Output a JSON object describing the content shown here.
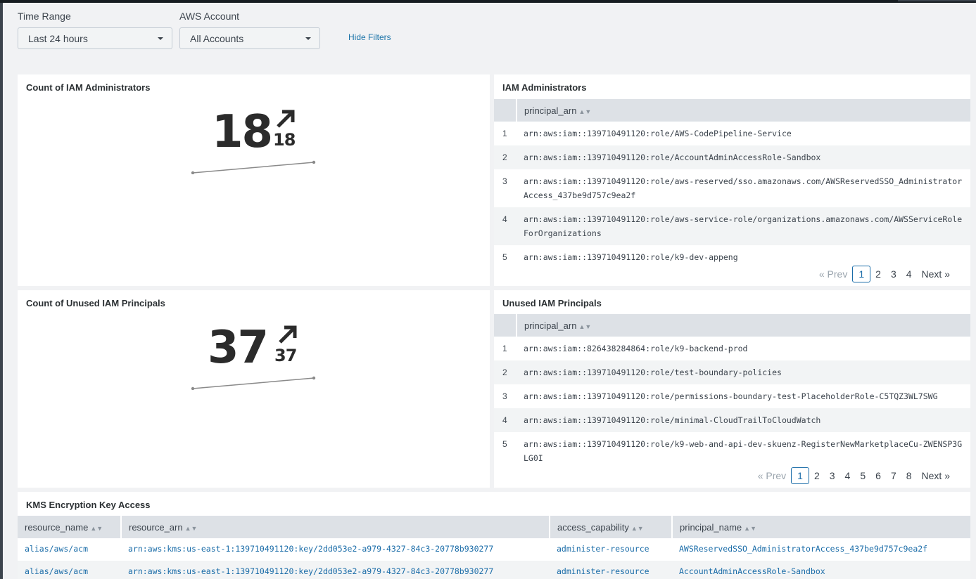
{
  "filters": {
    "time_range": {
      "label": "Time Range",
      "value": "Last 24 hours"
    },
    "aws_account": {
      "label": "AWS Account",
      "value": "All Accounts"
    },
    "hide_filters_label": "Hide Filters"
  },
  "panels": {
    "count_admins": {
      "title": "Count of IAM Administrators",
      "value": "18",
      "delta": "18",
      "trend_icon": "arrow-up-right-icon",
      "sparkline": [
        0,
        18
      ]
    },
    "iam_admins": {
      "title": "IAM Administrators",
      "columns": [
        "principal_arn"
      ],
      "rows": [
        {
          "idx": "1",
          "principal_arn": "arn:aws:iam::139710491120:role/AWS-CodePipeline-Service"
        },
        {
          "idx": "2",
          "principal_arn": "arn:aws:iam::139710491120:role/AccountAdminAccessRole-Sandbox"
        },
        {
          "idx": "3",
          "principal_arn": "arn:aws:iam::139710491120:role/aws-reserved/sso.amazonaws.com/AWSReservedSSO_AdministratorAccess_437be9d757c9ea2f"
        },
        {
          "idx": "4",
          "principal_arn": "arn:aws:iam::139710491120:role/aws-service-role/organizations.amazonaws.com/AWSServiceRoleForOrganizations"
        },
        {
          "idx": "5",
          "principal_arn": "arn:aws:iam::139710491120:role/k9-dev-appeng"
        }
      ],
      "pager": {
        "prev": "« Prev",
        "pages": [
          "1",
          "2",
          "3",
          "4"
        ],
        "current": "1",
        "next": "Next »"
      }
    },
    "count_unused": {
      "title": "Count of Unused IAM Principals",
      "value": "37",
      "delta": "37",
      "trend_icon": "arrow-up-right-icon",
      "sparkline": [
        0,
        37
      ]
    },
    "unused_principals": {
      "title": "Unused IAM Principals",
      "columns": [
        "principal_arn"
      ],
      "rows": [
        {
          "idx": "1",
          "principal_arn": "arn:aws:iam::826438284864:role/k9-backend-prod"
        },
        {
          "idx": "2",
          "principal_arn": "arn:aws:iam::139710491120:role/test-boundary-policies"
        },
        {
          "idx": "3",
          "principal_arn": "arn:aws:iam::139710491120:role/permissions-boundary-test-PlaceholderRole-C5TQZ3WL7SWG"
        },
        {
          "idx": "4",
          "principal_arn": "arn:aws:iam::139710491120:role/minimal-CloudTrailToCloudWatch"
        },
        {
          "idx": "5",
          "principal_arn": "arn:aws:iam::139710491120:role/k9-web-and-api-dev-skuenz-RegisterNewMarketplaceCu-ZWENSP3GLG0I"
        }
      ],
      "pager": {
        "prev": "« Prev",
        "pages": [
          "1",
          "2",
          "3",
          "4",
          "5",
          "6",
          "7",
          "8"
        ],
        "current": "1",
        "next": "Next »"
      }
    },
    "kms": {
      "title": "KMS Encryption Key Access",
      "columns": [
        "resource_name",
        "resource_arn",
        "access_capability",
        "principal_name"
      ],
      "rows": [
        {
          "resource_name": "alias/aws/acm",
          "resource_arn": "arn:aws:kms:us-east-1:139710491120:key/2dd053e2-a979-4327-84c3-20778b930277",
          "access_capability": "administer-resource",
          "principal_name": "AWSReservedSSO_AdministratorAccess_437be9d757c9ea2f"
        },
        {
          "resource_name": "alias/aws/acm",
          "resource_arn": "arn:aws:kms:us-east-1:139710491120:key/2dd053e2-a979-4327-84c3-20778b930277",
          "access_capability": "administer-resource",
          "principal_name": "AccountAdminAccessRole-Sandbox"
        }
      ]
    }
  },
  "colors": {
    "link": "#1a6ca8",
    "header_bg": "#dde1e6",
    "page_bg": "#f1f2f4"
  }
}
